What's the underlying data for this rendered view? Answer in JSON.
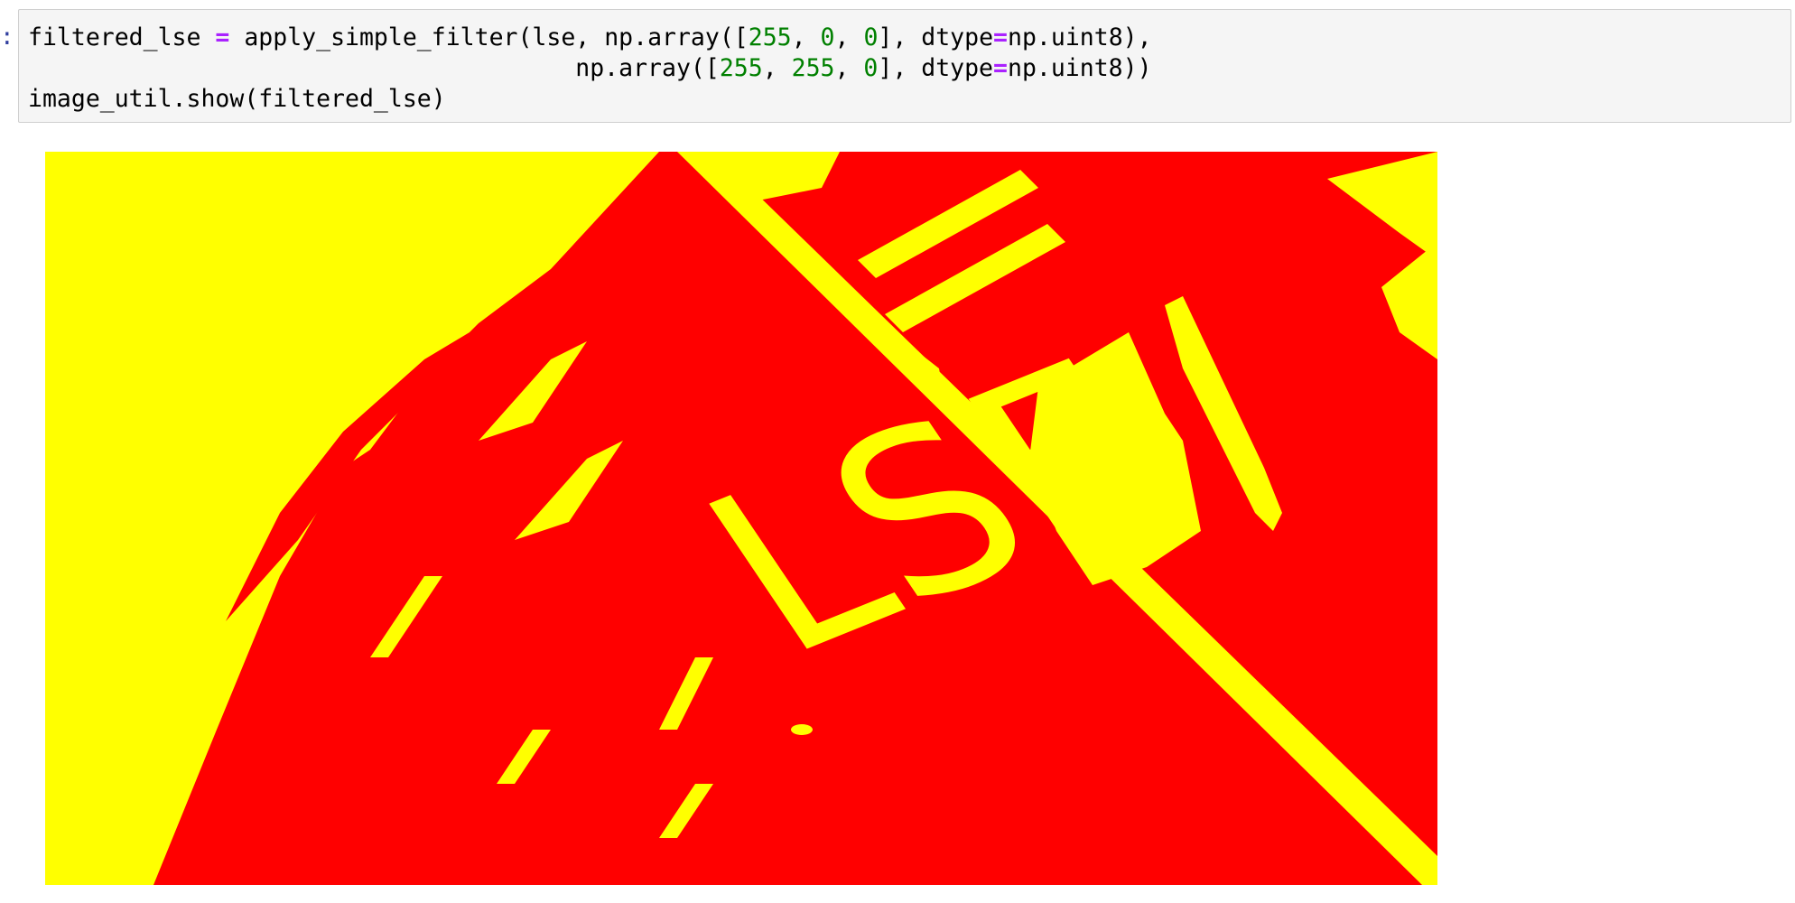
{
  "cell": {
    "prompt": ":",
    "code_lines": [
      [
        {
          "t": "filtered_lse ",
          "k": "text"
        },
        {
          "t": "=",
          "k": "op"
        },
        {
          "t": " apply_simple_filter(lse, np.array([",
          "k": "text"
        },
        {
          "t": "255",
          "k": "num"
        },
        {
          "t": ", ",
          "k": "text"
        },
        {
          "t": "0",
          "k": "num"
        },
        {
          "t": ", ",
          "k": "text"
        },
        {
          "t": "0",
          "k": "num"
        },
        {
          "t": "], dtype",
          "k": "text"
        },
        {
          "t": "=",
          "k": "op"
        },
        {
          "t": "np.uint8),",
          "k": "text"
        }
      ],
      [
        {
          "t": "                                      np.array([",
          "k": "text"
        },
        {
          "t": "255",
          "k": "num"
        },
        {
          "t": ", ",
          "k": "text"
        },
        {
          "t": "255",
          "k": "num"
        },
        {
          "t": ", ",
          "k": "text"
        },
        {
          "t": "0",
          "k": "num"
        },
        {
          "t": "], dtype",
          "k": "text"
        },
        {
          "t": "=",
          "k": "op"
        },
        {
          "t": "np.uint8))",
          "k": "text"
        }
      ],
      [
        {
          "t": "image_util.show(filtered_lse)",
          "k": "text"
        }
      ]
    ]
  },
  "output_image": {
    "sign_text": "LSE",
    "colors": {
      "filter_red": "#ff0000",
      "filter_yellow": "#ffff00"
    }
  },
  "colors": {
    "code_background": "#f5f5f5",
    "code_border": "#cfcfcf",
    "prompt": "#303f9f",
    "operator": "#aa22ff",
    "number": "#008000"
  }
}
